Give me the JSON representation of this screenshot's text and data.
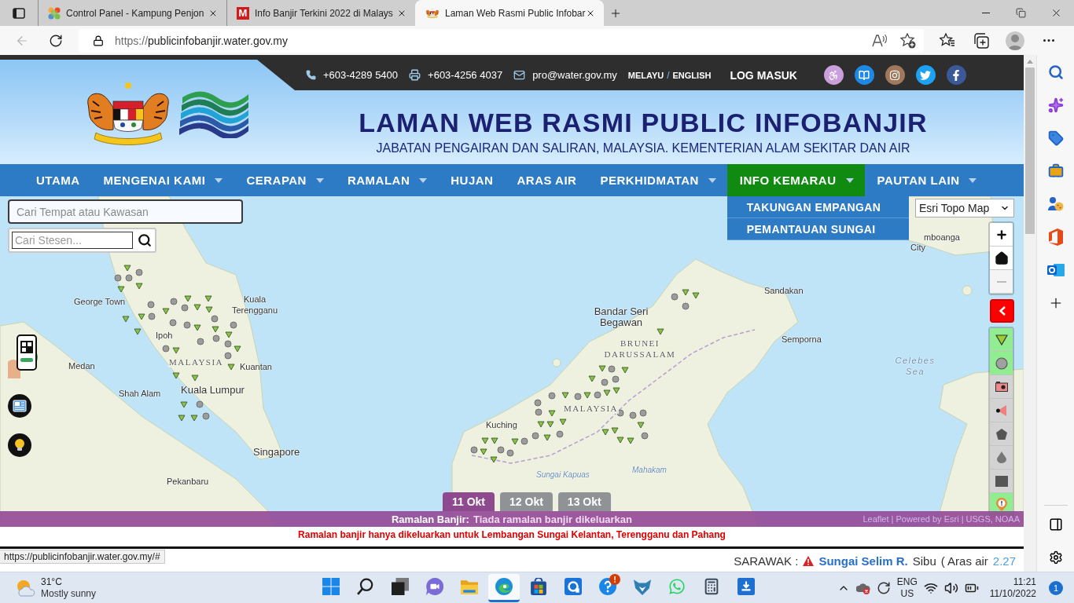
{
  "browser": {
    "tabs": [
      {
        "title": "Control Panel - Kampung Penjon",
        "kind": "puzzle",
        "selected": false
      },
      {
        "title": "Info Banjir Terkini 2022 di Malays",
        "kind": "letter",
        "favicon_text": "M",
        "selected": false
      },
      {
        "title": "Laman Web Rasmi Public Infobar",
        "kind": "crest",
        "selected": true
      }
    ],
    "back_disabled": true,
    "url_scheme": "https://",
    "url_host": "publicinfobanjir.water.gov.my"
  },
  "topbar": {
    "phone": "+603-4289 5400",
    "fax": "+603-4256 4037",
    "email": "pro@water.gov.my",
    "languages": [
      "MELAYU",
      "ENGLISH"
    ],
    "language_separator": "/",
    "login": "LOG MASUK"
  },
  "header": {
    "title": "LAMAN WEB RASMI PUBLIC INFOBANJIR",
    "subtitle": "JABATAN PENGAIRAN DAN SALIRAN, MALAYSIA. KEMENTERIAN ALAM SEKITAR DAN AIR"
  },
  "nav": [
    {
      "label": "UTAMA",
      "has_menu": false,
      "expanded": false
    },
    {
      "label": "MENGENAI KAMI",
      "has_menu": true,
      "expanded": false
    },
    {
      "label": "CERAPAN",
      "has_menu": true,
      "expanded": false
    },
    {
      "label": "RAMALAN",
      "has_menu": true,
      "expanded": false
    },
    {
      "label": "HUJAN",
      "has_menu": false,
      "expanded": false
    },
    {
      "label": "ARAS AIR",
      "has_menu": false,
      "expanded": false
    },
    {
      "label": "PERKHIDMATAN",
      "has_menu": true,
      "expanded": false
    },
    {
      "label": "INFO KEMARAU",
      "has_menu": true,
      "expanded": true,
      "menu": [
        "TAKUNGAN EMPANGAN",
        "PEMANTAUAN SUNGAI"
      ]
    },
    {
      "label": "PAUTAN LAIN",
      "has_menu": true,
      "expanded": false
    }
  ],
  "map": {
    "place_search": {
      "placeholder": "Cari Tempat atau Kawasan"
    },
    "station_search": {
      "placeholder": "Cari Stesen..."
    },
    "basemap": "Esri Topo Map",
    "zoom_out_disabled": true,
    "labels": [
      {
        "text": "George Town",
        "kind": "city"
      },
      {
        "text": "Kuala Terengganu",
        "kind": "city"
      },
      {
        "text": "Ipoh",
        "kind": "city"
      },
      {
        "text": "MALAYSIA",
        "kind": "country"
      },
      {
        "text": "Medan",
        "kind": "city"
      },
      {
        "text": "Kuantan",
        "kind": "city"
      },
      {
        "text": "Shah Alam",
        "kind": "city"
      },
      {
        "text": "Kuala Lumpur",
        "kind": "capital"
      },
      {
        "text": "Singapore",
        "kind": "capital"
      },
      {
        "text": "Pekanbaru",
        "kind": "city"
      },
      {
        "text": "Bandar Seri Begawan",
        "kind": "capital"
      },
      {
        "text": "BRUNEI DARUSSALAM",
        "kind": "country"
      },
      {
        "text": "MALAYSIA",
        "kind": "country"
      },
      {
        "text": "Sandakan",
        "kind": "city"
      },
      {
        "text": "Semporna",
        "kind": "city"
      },
      {
        "text": "Celebes Sea",
        "kind": "sea"
      },
      {
        "text": "Kuching",
        "kind": "city"
      },
      {
        "text": "mboanga",
        "kind": "city"
      },
      {
        "text": "City",
        "kind": "city"
      },
      {
        "text": "Sungai Kapuas",
        "kind": "river"
      },
      {
        "text": "Mahakam",
        "kind": "river"
      }
    ],
    "layers": [
      {
        "kind": "triangle",
        "on": true
      },
      {
        "kind": "circle",
        "on": true
      },
      {
        "kind": "camera",
        "on": false
      },
      {
        "kind": "siren",
        "on": false
      },
      {
        "kind": "pentagon",
        "on": false
      },
      {
        "kind": "drop",
        "on": false
      },
      {
        "kind": "square",
        "on": false
      },
      {
        "kind": "pin",
        "on": true
      }
    ],
    "dates": [
      {
        "label": "11 Okt",
        "selected": true
      },
      {
        "label": "12 Okt",
        "selected": false
      },
      {
        "label": "13 Okt",
        "selected": false
      }
    ],
    "attribution": "Leaflet | Powered by Esri | USGS, NOAA"
  },
  "forecast": {
    "label": "Ramalan Banjir:",
    "text": "Tiada ramalan banjir dikeluarkan",
    "note": "Ramalan banjir hanya dikeluarkan untuk Lembangan Sungai Kelantan, Terengganu dan Pahang"
  },
  "ticker": {
    "region": "SARAWAK :",
    "river": "Sungai Selim R.",
    "place": "Sibu",
    "reading_label": "( Aras air",
    "reading": "2.27"
  },
  "status_url": "https://publicinfobanjir.water.gov.my/#",
  "taskbar": {
    "temperature": "31°C",
    "condition": "Mostly sunny",
    "apps": [
      {
        "kind": "start",
        "active": false
      },
      {
        "kind": "search",
        "active": false
      },
      {
        "kind": "task-view",
        "active": false
      },
      {
        "kind": "chat",
        "active": false
      },
      {
        "kind": "folder",
        "active": false
      },
      {
        "kind": "edge",
        "active": true
      },
      {
        "kind": "store",
        "active": false
      },
      {
        "kind": "tile-app",
        "active": false
      },
      {
        "kind": "help",
        "active": false,
        "badge": "!"
      },
      {
        "kind": "fox",
        "active": false
      },
      {
        "kind": "whatsapp",
        "active": false
      },
      {
        "kind": "calculator",
        "active": false
      },
      {
        "kind": "scanner",
        "active": false
      }
    ],
    "language": "ENG",
    "region": "US",
    "time": "11:21",
    "date": "11/10/2022",
    "notifications": "1"
  }
}
